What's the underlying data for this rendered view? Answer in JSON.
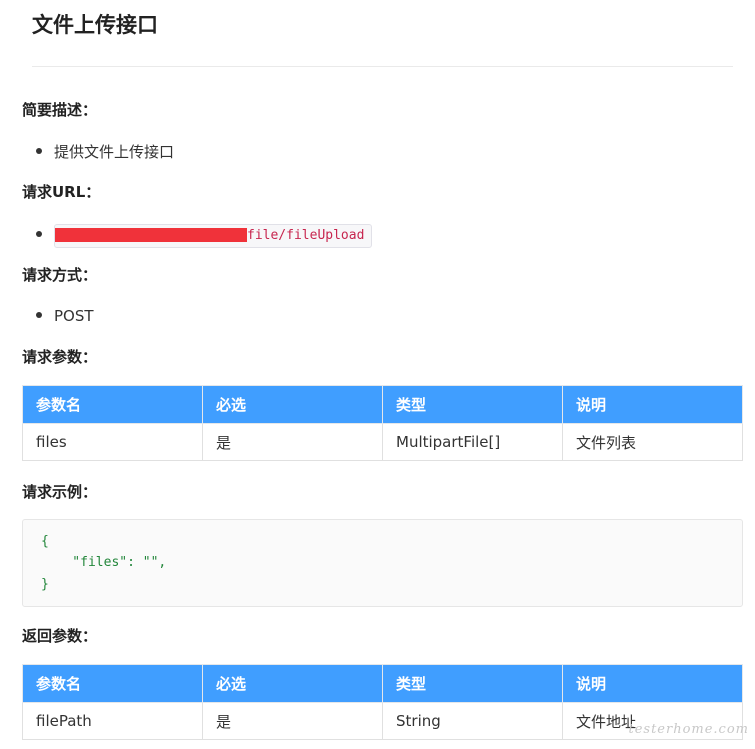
{
  "page": {
    "title": "文件上传接口"
  },
  "sections": {
    "summary_label": "简要描述：",
    "summary_item": "提供文件上传接口",
    "url_label": "请求URL：",
    "url_visible": "file/fileUpload",
    "method_label": "请求方式：",
    "method_item": "POST",
    "params_label": "请求参数：",
    "example_label": "请求示例：",
    "return_label": "返回参数："
  },
  "request_params": {
    "headers": [
      "参数名",
      "必选",
      "类型",
      "说明"
    ],
    "rows": [
      [
        "files",
        "是",
        "MultipartFile[]",
        "文件列表"
      ]
    ]
  },
  "request_example": {
    "lines": [
      "{",
      "    \"files\": \"\",",
      "}"
    ]
  },
  "return_params": {
    "headers": [
      "参数名",
      "必选",
      "类型",
      "说明"
    ],
    "rows": [
      [
        "filePath",
        "是",
        "String",
        "文件地址"
      ]
    ]
  },
  "watermark": "testerhome.com",
  "colors": {
    "table_header": "#409eff",
    "code_text": "#22863a",
    "inline_code": "#c7254e",
    "redaction": "#f0323a"
  }
}
